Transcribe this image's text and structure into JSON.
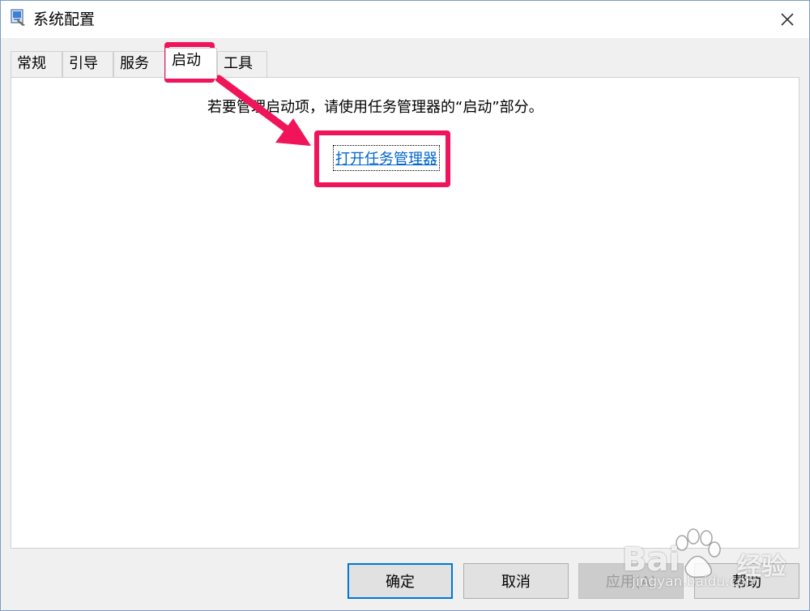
{
  "window": {
    "title": "系统配置"
  },
  "tabs": [
    {
      "label": "常规",
      "active": false
    },
    {
      "label": "引导",
      "active": false
    },
    {
      "label": "服务",
      "active": false
    },
    {
      "label": "启动",
      "active": true
    },
    {
      "label": "工具",
      "active": false
    }
  ],
  "panel": {
    "message": "若要管理启动项，请使用任务管理器的“启动”部分。",
    "link": "打开任务管理器"
  },
  "buttons": {
    "ok": "确定",
    "cancel": "取消",
    "apply": "应用(A)",
    "help": "帮助"
  },
  "watermark": {
    "brand": "Bai",
    "brand_suffix": "经验",
    "url": "jingyan.baidu.com"
  },
  "colors": {
    "highlight": "#f0145a",
    "link": "#0066cc",
    "focus": "#0078d7"
  },
  "icons": {
    "app": "msconfig-icon",
    "close": "close-icon"
  }
}
